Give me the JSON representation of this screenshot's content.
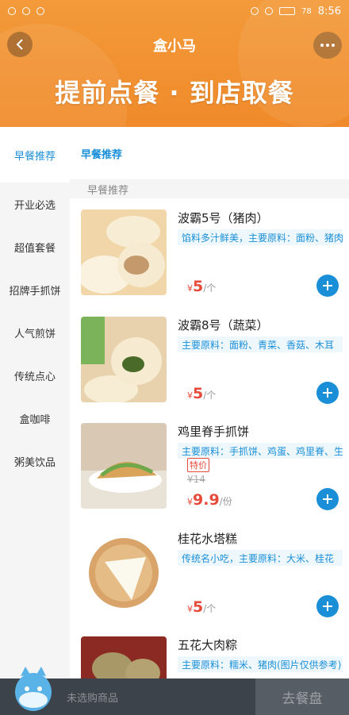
{
  "status_bar": {
    "time": "8:56",
    "battery": "78"
  },
  "header": {
    "title": "盒小马",
    "banner": "提前点餐 · 到店取餐"
  },
  "sidebar": {
    "items": [
      {
        "label": "早餐推荐",
        "active": true
      },
      {
        "label": "开业必选"
      },
      {
        "label": "超值套餐"
      },
      {
        "label": "招牌手抓饼"
      },
      {
        "label": "人气煎饼"
      },
      {
        "label": "传统点心"
      },
      {
        "label": "盒咖啡"
      },
      {
        "label": "粥美饮品"
      }
    ]
  },
  "main": {
    "category_title": "早餐推荐",
    "section_label": "早餐推荐",
    "products": [
      {
        "name": "波霸5号（猪肉）",
        "tag": "馅料多汁鲜美，主要原料：面粉、猪肉",
        "currency": "¥",
        "price": "5",
        "unit": "/个"
      },
      {
        "name": "波霸8号（蔬菜）",
        "tag": "主要原料：面粉、青菜、香菇、木耳",
        "currency": "¥",
        "price": "5",
        "unit": "/个"
      },
      {
        "name": "鸡里脊手抓饼",
        "tag": "主要原料：手抓饼、鸡蛋、鸡里脊、生菜",
        "badge": "特价",
        "original_price": "¥14",
        "currency": "¥",
        "price": "9.9",
        "unit": "/份"
      },
      {
        "name": "桂花水塔糕",
        "tag": "传统名小吃，主要原料：大米、桂花",
        "currency": "¥",
        "price": "5",
        "unit": "/个"
      },
      {
        "name": "五花大肉粽",
        "tag": "主要原料：糯米、猪肉(图片仅供参考)"
      }
    ]
  },
  "bottom_bar": {
    "cart_text": "未选购商品",
    "checkout_label": "去餐盘"
  },
  "colors": {
    "brand_orange": "#f08a2a",
    "accent_blue": "#1a8fd8",
    "price_red": "#e84a3a",
    "bottom_dark": "#3d434a"
  }
}
